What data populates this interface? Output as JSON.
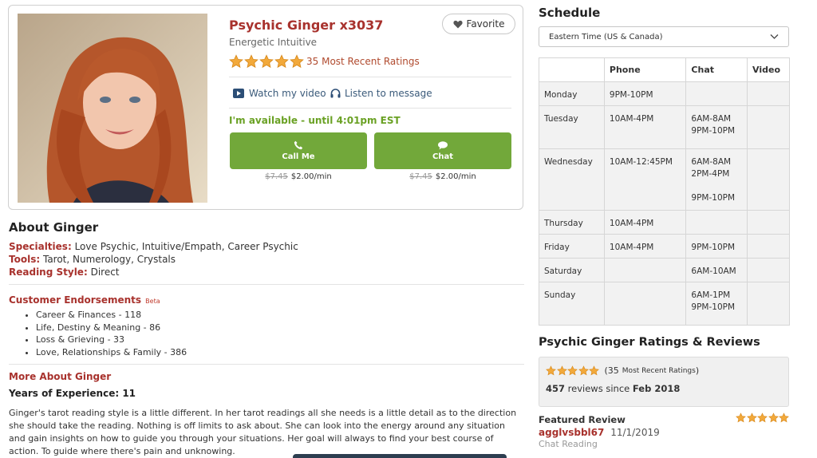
{
  "profile": {
    "name": "Psychic Ginger x3037",
    "subtitle": "Energetic Intuitive",
    "rating_count_text": "35 Most Recent Ratings",
    "stars": 5,
    "favorite_label": "Favorite",
    "watch_video": "Watch my video",
    "listen_message": "Listen to message",
    "availability": "I'm available - until 4:01pm EST",
    "call_label": "Call Me",
    "chat_label": "Chat",
    "call_old_price": "$7.45",
    "call_price": "$2.00/min",
    "chat_old_price": "$7.45",
    "chat_price": "$2.00/min",
    "accent_color": "#72a83a",
    "name_color": "#a8322d"
  },
  "about": {
    "title": "About Ginger",
    "specialties_label": "Specialties:",
    "specialties": "Love Psychic, Intuitive/Empath, Career Psychic",
    "tools_label": "Tools:",
    "tools": "Tarot, Numerology, Crystals",
    "style_label": "Reading Style:",
    "style": "Direct",
    "endorsements_title": "Customer Endorsements",
    "endorsements_badge": "Beta",
    "endorsements": [
      "Career & Finances - 118",
      "Life, Destiny & Meaning - 86",
      "Loss & Grieving - 33",
      "Love, Relationships & Family - 386"
    ],
    "more_title": "More About Ginger",
    "experience": "Years of Experience: 11",
    "bio": "Ginger's tarot reading style is a little different. In her tarot readings all she needs is a little detail as to the direction she should take the reading. Nothing is off limits to ask about. She can look into the energy around any situation and gain insights on how to guide you through your situations. Her goal will always to find your best course of action. To guide where there's pain and unknowing."
  },
  "schedule": {
    "title": "Schedule",
    "timezone": "Eastern Time (US & Canada)",
    "headers": [
      "",
      "Phone",
      "Chat",
      "Video"
    ],
    "rows": [
      {
        "day": "Monday",
        "phone": "9PM-10PM",
        "chat": "",
        "video": ""
      },
      {
        "day": "Tuesday",
        "phone": "10AM-4PM",
        "chat": "6AM-8AM\n9PM-10PM",
        "video": ""
      },
      {
        "day": "Wednesday",
        "phone": "10AM-12:45PM",
        "chat": "6AM-8AM\n2PM-4PM\n\n9PM-10PM",
        "video": ""
      },
      {
        "day": "Thursday",
        "phone": "10AM-4PM",
        "chat": "",
        "video": ""
      },
      {
        "day": "Friday",
        "phone": "10AM-4PM",
        "chat": "9PM-10PM",
        "video": ""
      },
      {
        "day": "Saturday",
        "phone": "",
        "chat": "6AM-10AM",
        "video": ""
      },
      {
        "day": "Sunday",
        "phone": "",
        "chat": "6AM-1PM\n9PM-10PM",
        "video": ""
      }
    ]
  },
  "reviews": {
    "title": "Psychic Ginger Ratings & Reviews",
    "count_text": "(35",
    "count_small": "Most Recent Ratings",
    "count_close": ")",
    "reviews_number": "457",
    "reviews_since": "reviews since",
    "since_date": "Feb 2018",
    "featured_label": "Featured Review",
    "featured_user": "agglvsbbl67",
    "featured_date": "11/1/2019",
    "featured_type": "Chat Reading"
  }
}
